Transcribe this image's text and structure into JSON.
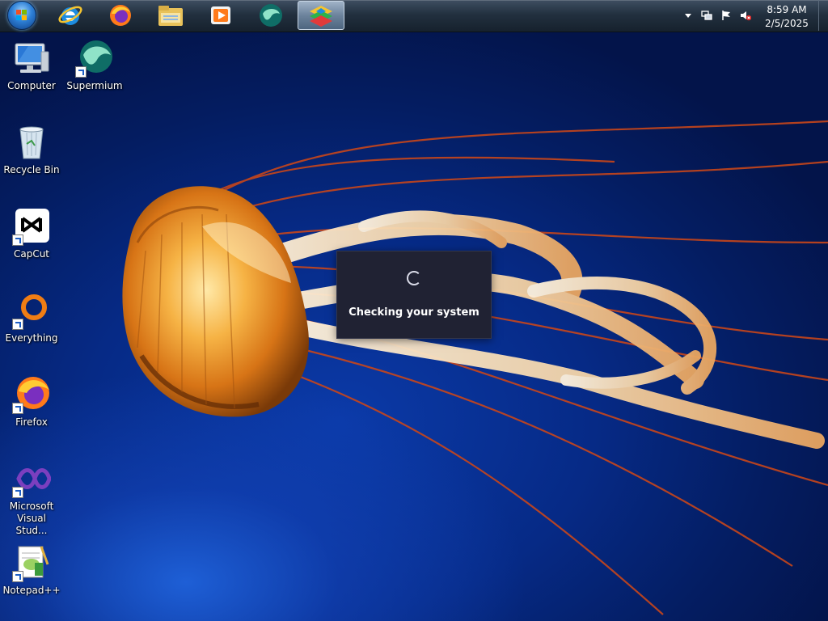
{
  "taskbar": {
    "pinned": [
      {
        "name": "start-button",
        "icon": "windows-orb-icon"
      },
      {
        "name": "internet-explorer",
        "icon": "internet-explorer-icon"
      },
      {
        "name": "firefox",
        "icon": "firefox-icon"
      },
      {
        "name": "file-explorer",
        "icon": "folder-icon"
      },
      {
        "name": "media-player",
        "icon": "media-player-icon"
      },
      {
        "name": "supermium",
        "icon": "supermium-icon"
      },
      {
        "name": "bluestacks",
        "icon": "bluestacks-icon",
        "active": true
      }
    ],
    "tray": {
      "time": "8:59 AM",
      "date": "2/5/2025",
      "icons": [
        "show-hidden-icons-chevron",
        "network-icon",
        "action-center-flag-icon",
        "volume-muted-icon"
      ]
    }
  },
  "desktop": {
    "icons": [
      {
        "label": "Computer",
        "icon": "computer-icon",
        "shortcut": false
      },
      {
        "label": "Supermium",
        "icon": "supermium-icon",
        "shortcut": true
      },
      {
        "label": "Recycle Bin",
        "icon": "recycle-bin-icon",
        "shortcut": false
      },
      {
        "label": "CapCut",
        "icon": "capcut-icon",
        "shortcut": true
      },
      {
        "label": "Everything",
        "icon": "everything-search-icon",
        "shortcut": true
      },
      {
        "label": "Firefox",
        "icon": "firefox-icon",
        "shortcut": true
      },
      {
        "label": "Microsoft Visual Stud...",
        "icon": "visual-studio-icon",
        "shortcut": true
      },
      {
        "label": "Notepad++",
        "icon": "notepad-plus-plus-icon",
        "shortcut": true
      }
    ]
  },
  "dialog": {
    "message": "Checking your system",
    "spinner": "loading-spinner-icon",
    "background": "#202233"
  },
  "colors": {
    "desktop_blue": "#0b3aa8",
    "jellyfish_orange": "#e8801f",
    "taskbar": "#22303f"
  }
}
